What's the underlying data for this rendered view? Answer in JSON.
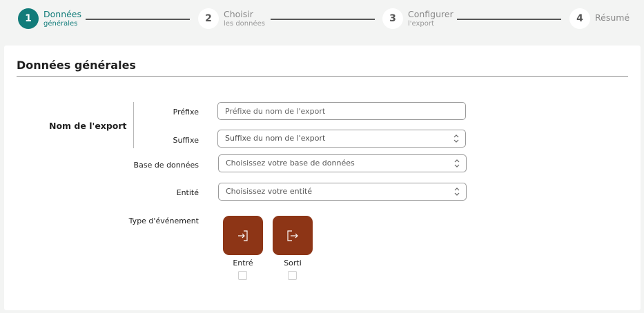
{
  "stepper": {
    "steps": [
      {
        "number": "1",
        "label": "Données",
        "sub": "générales"
      },
      {
        "number": "2",
        "label": "Choisir",
        "sub": "les données"
      },
      {
        "number": "3",
        "label": "Configurer",
        "sub": "l'export"
      },
      {
        "number": "4",
        "label": "Résumé",
        "sub": ""
      }
    ],
    "active_step": 1
  },
  "form": {
    "title": "Données générales",
    "export_name_group": "Nom de l'export",
    "prefix": {
      "label": "Préfixe",
      "placeholder": "Préfixe du nom de l'export",
      "value": ""
    },
    "suffix": {
      "label": "Suffixe",
      "value": "Suffixe du nom de l'export"
    },
    "database": {
      "label": "Base de données",
      "value": "Choisissez votre base de données"
    },
    "entity": {
      "label": "Entité",
      "value": "Choisissez votre entité"
    },
    "event_type": {
      "label": "Type d'événement",
      "options": [
        {
          "label": "Entré",
          "icon": "login-icon",
          "checked": false
        },
        {
          "label": "Sorti",
          "icon": "logout-icon",
          "checked": false
        }
      ]
    }
  },
  "colors": {
    "accent": "#127c7a",
    "event_button": "#8d3516"
  }
}
